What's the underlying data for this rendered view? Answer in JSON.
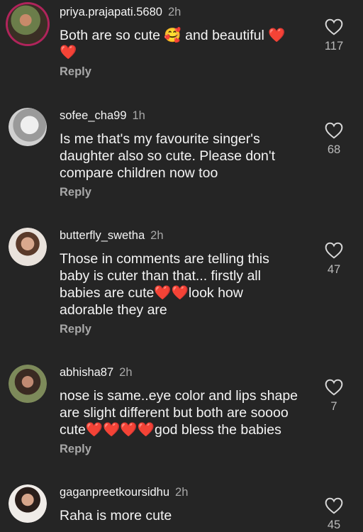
{
  "comments": [
    {
      "username": "priya.prajapati.5680",
      "time": "2h",
      "text": "Both are so cute 🥰 and beautiful ❤️\n❤️",
      "reply": "Reply",
      "likes": "117",
      "avatar_color": "#7a5a3a"
    },
    {
      "username": "sofee_cha99",
      "time": "1h",
      "text": "Is me that's my favourite singer's\ndaughter also so cute. Please don't\ncompare children now too",
      "reply": "Reply",
      "likes": "68",
      "avatar_color": "#cfcfcf"
    },
    {
      "username": "butterfly_swetha",
      "time": "2h",
      "text": "Those in comments are telling this\nbaby is cuter than that... firstly all\nbabies are cute❤️❤️look how\nadorable they are",
      "reply": "Reply",
      "likes": "47",
      "avatar_color": "#d8c2b8"
    },
    {
      "username": "abhisha87",
      "time": "2h",
      "text": "nose is same..eye color and lips shape\nare slight different but both are soooo\ncute❤️❤️❤️❤️god bless the babies",
      "reply": "Reply",
      "likes": "7",
      "avatar_color": "#6a5a4a"
    },
    {
      "username": "gaganpreetkoursidhu",
      "time": "2h",
      "text": "Raha is more cute",
      "reply": "",
      "likes": "45",
      "avatar_color": "#c9b6a6"
    }
  ]
}
